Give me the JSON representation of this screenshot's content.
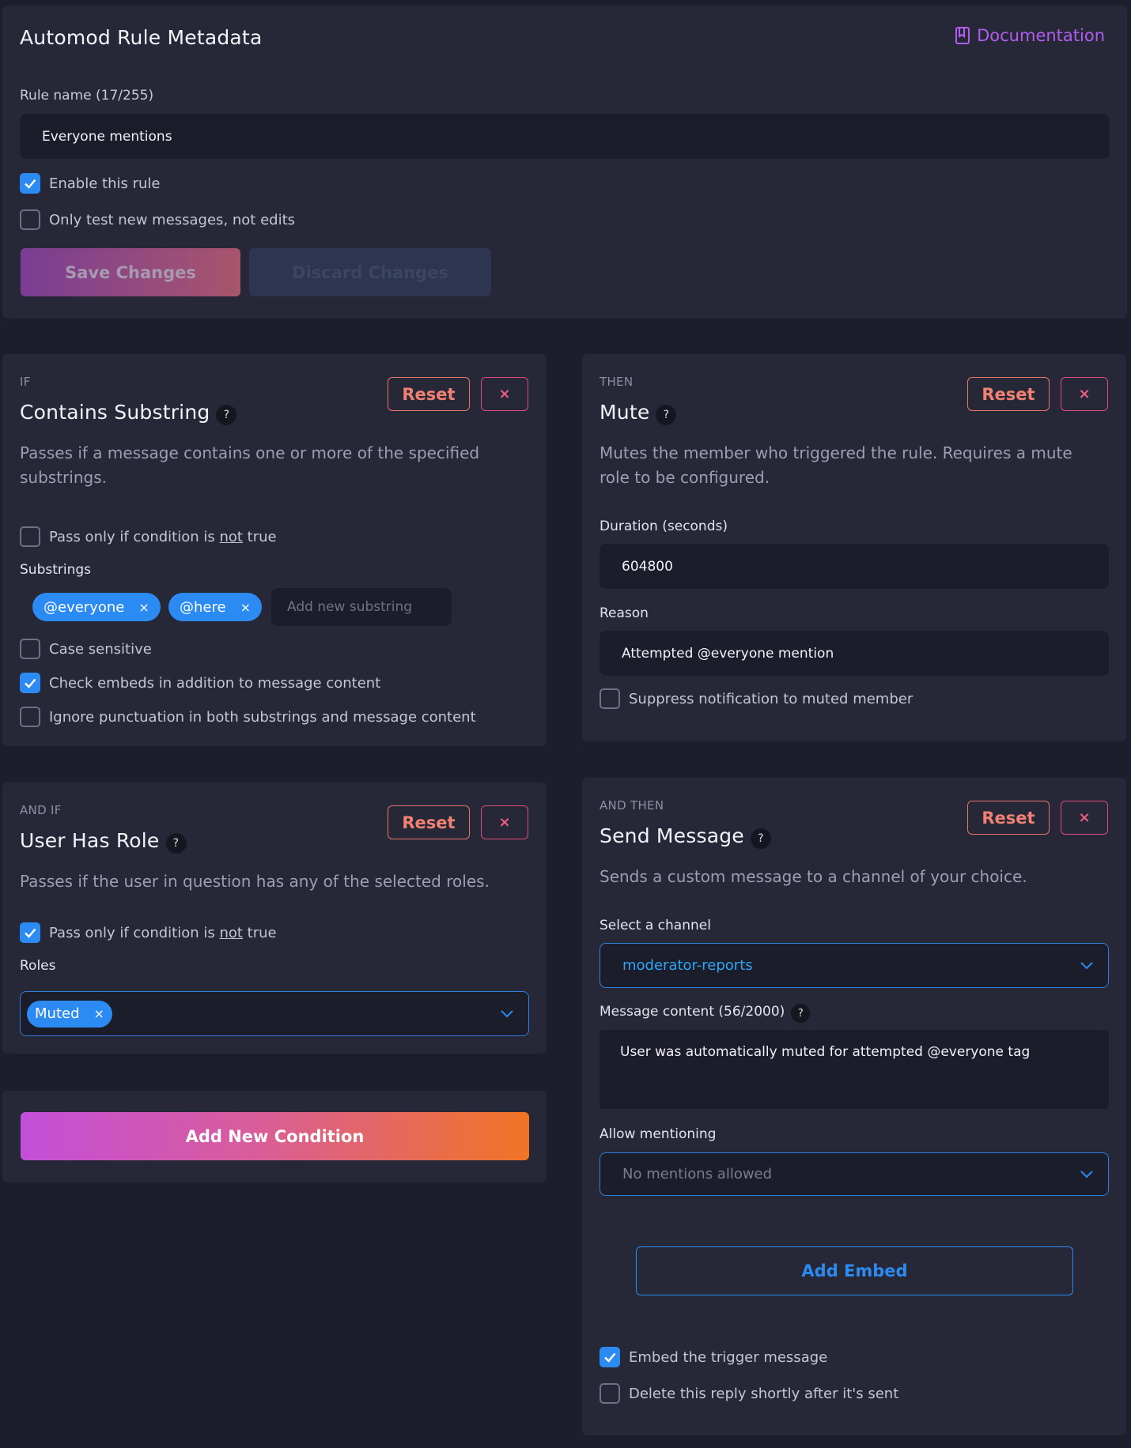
{
  "metadata": {
    "title": "Automod Rule Metadata",
    "docs_label": "Documentation",
    "rule_name_label": "Rule name (17/255)",
    "rule_name_value": "Everyone mentions",
    "enable_label": "Enable this rule",
    "enable_checked": true,
    "only_new_label": "Only test new messages, not edits",
    "only_new_checked": false,
    "save_label": "Save Changes",
    "discard_label": "Discard Changes"
  },
  "condition1": {
    "kicker": "IF",
    "title": "Contains Substring",
    "help": "?",
    "reset_label": "Reset",
    "remove_label": "×",
    "description": "Passes if a message contains one or more of the specified substrings.",
    "negate_prefix": "Pass only if condition is ",
    "negate_word": "not",
    "negate_suffix": " true",
    "negate_checked": false,
    "substrings_label": "Substrings",
    "substrings": [
      "@everyone",
      "@here"
    ],
    "chip_remove": "×",
    "add_placeholder": "Add new substring",
    "case_label": "Case sensitive",
    "case_checked": false,
    "embeds_label": "Check embeds in addition to message content",
    "embeds_checked": true,
    "punct_label": "Ignore punctuation in both substrings and message content",
    "punct_checked": false
  },
  "condition2": {
    "kicker": "AND IF",
    "title": "User Has Role",
    "help": "?",
    "reset_label": "Reset",
    "remove_label": "×",
    "description": "Passes if the user in question has any of the selected roles.",
    "negate_prefix": "Pass only if condition is ",
    "negate_word": "not",
    "negate_suffix": " true",
    "negate_checked": true,
    "roles_label": "Roles",
    "roles": [
      "Muted"
    ],
    "chip_remove": "×"
  },
  "add_condition_label": "Add New Condition",
  "action1": {
    "kicker": "THEN",
    "title": "Mute",
    "help": "?",
    "reset_label": "Reset",
    "remove_label": "×",
    "description": "Mutes the member who triggered the rule. Requires a mute role to be configured.",
    "duration_label": "Duration (seconds)",
    "duration_value": "604800",
    "reason_label": "Reason",
    "reason_value": "Attempted @everyone mention",
    "suppress_label": "Suppress notification to muted member",
    "suppress_checked": false
  },
  "action2": {
    "kicker": "AND THEN",
    "title": "Send Message",
    "help": "?",
    "reset_label": "Reset",
    "remove_label": "×",
    "description": "Sends a custom message to a channel of your choice.",
    "channel_label": "Select a channel",
    "channel_value": "moderator-reports",
    "content_label": "Message content (56/2000)",
    "content_value": "User was automatically muted for attempted @everyone tag",
    "mentions_label": "Allow mentioning",
    "mentions_placeholder": "No mentions allowed",
    "add_embed_label": "Add Embed",
    "embed_trigger_label": "Embed the trigger message",
    "embed_trigger_checked": true,
    "delete_reply_label": "Delete this reply shortly after it's sent",
    "delete_reply_checked": false
  },
  "colors": {
    "accent_blue": "#2b8bf2",
    "reset_orange": "#f08173",
    "remove_pink": "#ef5d84",
    "docs_purple": "#b35cf0",
    "gradient_start": "#c24fd9",
    "gradient_end": "#f07524"
  }
}
